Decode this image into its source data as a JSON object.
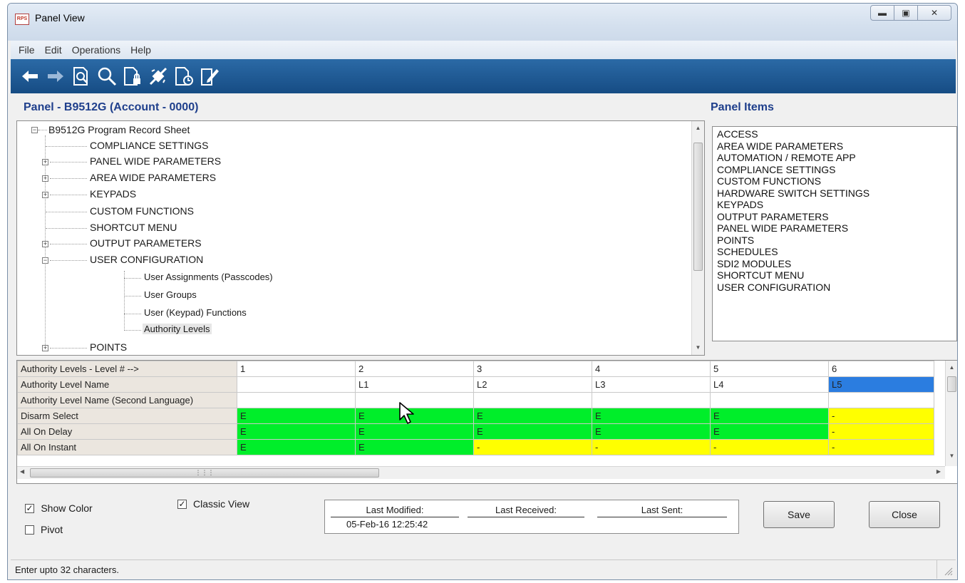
{
  "window": {
    "title": "Panel View",
    "app_icon_text": "RPS"
  },
  "menu": [
    "File",
    "Edit",
    "Operations",
    "Help"
  ],
  "toolbar_icons": [
    "back-arrow-icon",
    "forward-arrow-icon",
    "preview-icon",
    "search-icon",
    "lock-document-icon",
    "connect-icon",
    "history-icon",
    "edit-icon"
  ],
  "panel_title": "Panel - B9512G (Account - 0000)",
  "panel_items_title": "Panel Items",
  "tree": {
    "root": "B9512G Program Record Sheet",
    "items": [
      {
        "label": "COMPLIANCE SETTINGS"
      },
      {
        "label": "PANEL WIDE PARAMETERS"
      },
      {
        "label": "AREA WIDE PARAMETERS"
      },
      {
        "label": "KEYPADS"
      },
      {
        "label": "CUSTOM FUNCTIONS"
      },
      {
        "label": "SHORTCUT MENU"
      },
      {
        "label": "OUTPUT PARAMETERS"
      },
      {
        "label": "USER CONFIGURATION"
      },
      {
        "label": "User Assignments (Passcodes)"
      },
      {
        "label": "User Groups"
      },
      {
        "label": "User (Keypad) Functions"
      },
      {
        "label": "Authority Levels"
      },
      {
        "label": "POINTS"
      }
    ]
  },
  "panel_items": [
    "ACCESS",
    "AREA WIDE PARAMETERS",
    "AUTOMATION / REMOTE APP",
    "COMPLIANCE SETTINGS",
    "CUSTOM FUNCTIONS",
    "HARDWARE SWITCH SETTINGS",
    "KEYPADS",
    "OUTPUT PARAMETERS",
    "PANEL WIDE PARAMETERS",
    "POINTS",
    "SCHEDULES",
    "SDI2 MODULES",
    "SHORTCUT MENU",
    "USER CONFIGURATION"
  ],
  "grid": {
    "header_label": "Authority Levels  -  Level # -->",
    "columns": [
      "1",
      "2",
      "3",
      "4",
      "5",
      "6"
    ],
    "rows": [
      {
        "label": "Authority Level Name",
        "cells": [
          "",
          "L1",
          "L2",
          "L3",
          "L4",
          "L5"
        ]
      },
      {
        "label": "Authority Level Name (Second Language)",
        "cells": [
          "",
          "",
          "",
          "",
          "",
          ""
        ]
      },
      {
        "label": "Disarm Select",
        "cells": [
          "E",
          "E",
          "E",
          "E",
          "E",
          "-"
        ]
      },
      {
        "label": "All On Delay",
        "cells": [
          "E",
          "E",
          "E",
          "E",
          "E",
          "-"
        ]
      },
      {
        "label": "All On Instant",
        "cells": [
          "E",
          "E",
          "-",
          "-",
          "-",
          "-"
        ]
      }
    ]
  },
  "options": {
    "show_color": {
      "label": "Show Color",
      "checked": true
    },
    "pivot": {
      "label": "Pivot",
      "checked": false
    },
    "classic_view": {
      "label": "Classic View",
      "checked": true
    }
  },
  "info": {
    "last_modified_label": "Last Modified:",
    "last_received_label": "Last Received:",
    "last_sent_label": "Last Sent:",
    "last_modified_value": "05-Feb-16 12:25:42"
  },
  "buttons": {
    "save": "Save",
    "close": "Close"
  },
  "status": "Enter upto 32 characters.",
  "colors": {
    "enabled": "#00ee2a",
    "disabled": "#ffff00",
    "selected": "#2b7de0",
    "toolbar": "#1e5a96",
    "heading": "#1f3f8c"
  }
}
